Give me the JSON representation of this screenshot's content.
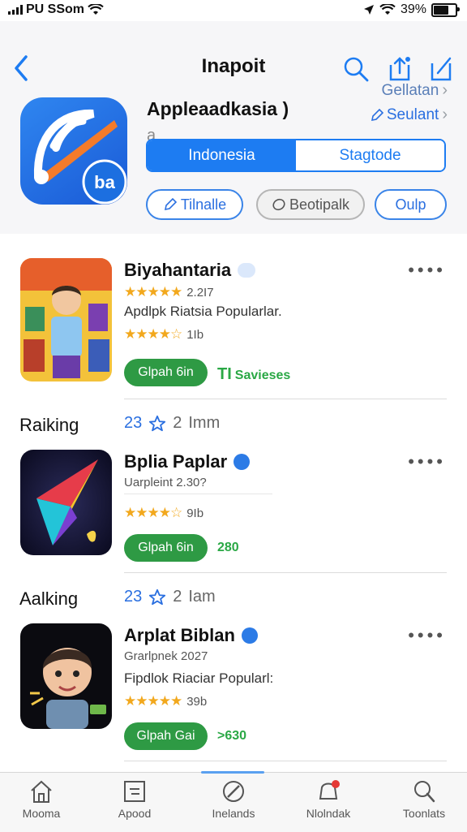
{
  "status": {
    "carrier": "PU SSom",
    "battery": "39%"
  },
  "nav": {
    "title": "Inapoit"
  },
  "app": {
    "name": "Appleaadkasia )",
    "subtitle": "a",
    "link1": "Gellatan",
    "link2": "Seulant",
    "segments": [
      "Indonesia",
      "Stagtode"
    ],
    "chips": [
      "Tilnalle",
      "Beotipalk",
      "Oulp"
    ]
  },
  "items": [
    {
      "title": "Biyahantaria",
      "stars": "★★★★★",
      "rating": "2.2I7",
      "desc": "Apdlpk Riatsia Popularlar.",
      "stars2": "★★★★☆",
      "count": "1Ib",
      "get": "Glpah 6in",
      "tag": "Savieses",
      "tag_icon": "TI"
    },
    {
      "title": "Bplia Paplar",
      "sub": "Uarpleint 2.30?",
      "stars": "★★★★☆",
      "count": "9Ib",
      "get": "Glpah 6in",
      "tag": "280"
    },
    {
      "title": "Arplat Biblan",
      "sub": "Grarlpnek 2027",
      "desc": "Fipdlok Riaciar Popularl:",
      "stars": "★★★★★",
      "count": "39b",
      "get": "Glpah Gai",
      "tag": ">630"
    }
  ],
  "ranks": [
    {
      "label": "Raiking",
      "num": "23",
      "value": "2",
      "unit": "Imm"
    },
    {
      "label": "Aalking",
      "num": "23",
      "value": "2",
      "unit": "Iam"
    }
  ],
  "tabs": [
    "Mooma",
    "Apood",
    "Inelands",
    "Nlolndak",
    "Toonlats"
  ],
  "colors": {
    "accent": "#1d7cf2",
    "get": "#2e9a44",
    "star": "#f2a81d"
  }
}
